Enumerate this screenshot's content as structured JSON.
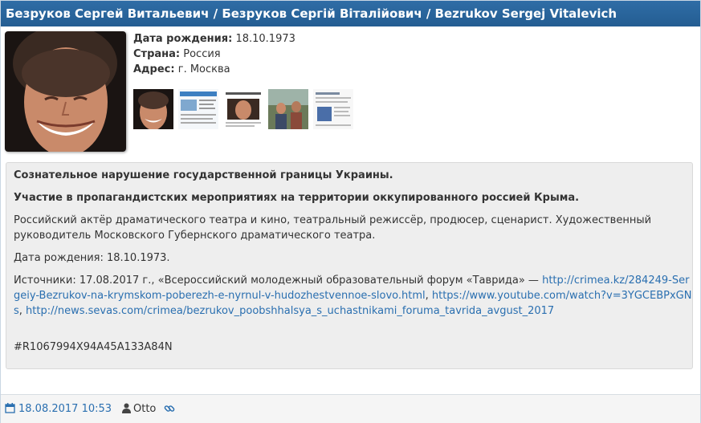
{
  "header": {
    "title": "Безруков Сергей Витальевич / Безруков Сергій Віталійович / Bezrukov Sergej Vitalevich"
  },
  "profile": {
    "birth_label": "Дата рождения:",
    "birth_value": "18.10.1973",
    "country_label": "Страна:",
    "country_value": "Россия",
    "address_label": "Адрес:",
    "address_value": "г. Москва",
    "thumbnails": [
      "portrait",
      "article-page",
      "article-portrait",
      "event-photo",
      "document-page"
    ]
  },
  "description": {
    "line1": "Сознательное нарушение государственной границы Украины.",
    "line2": "Участие в пропагандистских мероприятиях на территории оккупированного россией Крыма.",
    "bio": "Российский актёр драматического театра и кино, театральный режиссёр, продюсер, сценарист. Художественный руководитель Московского Губернского драматического театра.",
    "birth": "Дата рождения: 18.10.1973.",
    "sources_prefix": "Источники: 17.08.2017 г., «Всероссийский молодежный образовательный форум «Таврида» —",
    "link1": "http://crimea.kz/284249-Sergeiy-Bezrukov-na-krymskom-poberezh-e-nyrnul-v-hudozhestvennoe-slovo.html",
    "link2": "https://www.youtube.com/watch?v=3YGCEBPxGNs",
    "link3": "http://news.sevas.com/crimea/bezrukov_poobshhalsya_s_uchastnikami_foruma_tavrida_avgust_2017",
    "code": "#R1067994X94A45A133A84N"
  },
  "footer": {
    "date": "18.08.2017 10:53",
    "author": "Otto"
  },
  "colors": {
    "header": "#2f6da6",
    "link": "#2a6fb0",
    "panel_bg": "#eeeeee"
  }
}
